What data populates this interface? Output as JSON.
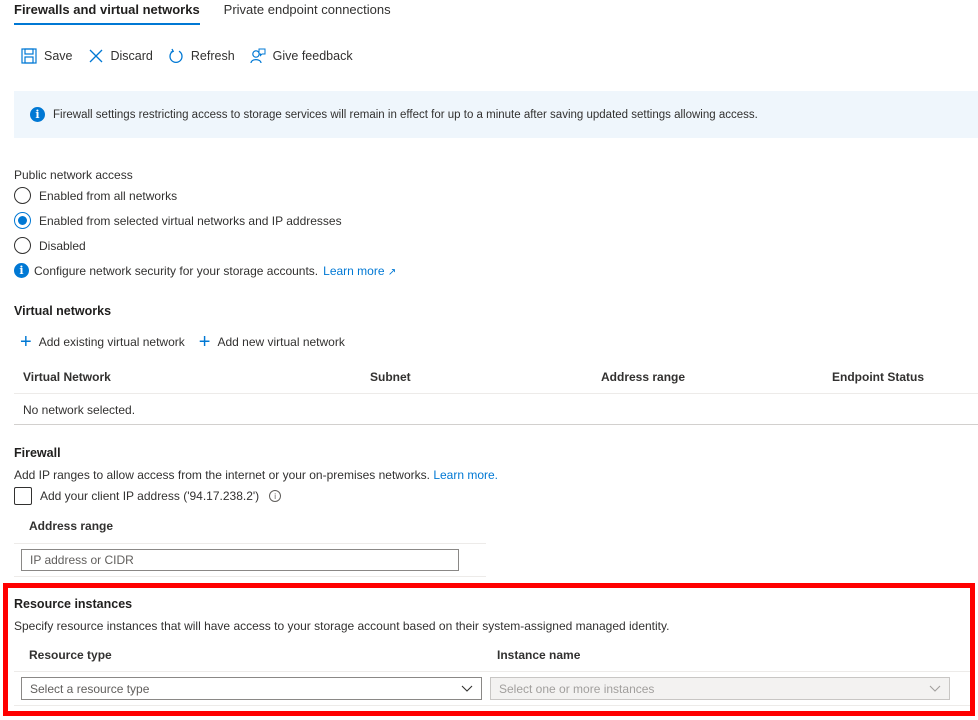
{
  "tabs": [
    {
      "label": "Firewalls and virtual networks",
      "active": true
    },
    {
      "label": "Private endpoint connections",
      "active": false
    }
  ],
  "toolbar": {
    "save": {
      "label": "Save",
      "icon": "save-icon"
    },
    "discard": {
      "label": "Discard",
      "icon": "close-icon"
    },
    "refresh": {
      "label": "Refresh",
      "icon": "refresh-icon"
    },
    "feedback": {
      "label": "Give feedback",
      "icon": "feedback-icon"
    }
  },
  "banner": {
    "icon": "info-icon",
    "text": "Firewall settings restricting access to storage services will remain in effect for up to a minute after saving updated settings allowing access."
  },
  "public_access": {
    "label": "Public network access",
    "options": [
      {
        "label": "Enabled from all networks",
        "selected": false
      },
      {
        "label": "Enabled from selected virtual networks and IP addresses",
        "selected": true
      },
      {
        "label": "Disabled",
        "selected": false
      }
    ],
    "info_text": "Configure network security for your storage accounts.",
    "learn_more": "Learn more"
  },
  "virtual_networks": {
    "title": "Virtual networks",
    "add_existing": "Add existing virtual network",
    "add_new": "Add new virtual network",
    "columns": [
      "Virtual Network",
      "Subnet",
      "Address range",
      "Endpoint Status"
    ],
    "empty_text": "No network selected."
  },
  "firewall": {
    "title": "Firewall",
    "description": "Add IP ranges to allow access from the internet or your on-premises networks.",
    "learn_more": "Learn more.",
    "client_ip_label": "Add your client IP address ('94.17.238.2')",
    "client_ip_checked": false,
    "address_range_header": "Address range",
    "address_placeholder": "IP address or CIDR"
  },
  "resource_instances": {
    "title": "Resource instances",
    "description": "Specify resource instances that will have access to your storage account based on their system-assigned managed identity.",
    "resource_type_header": "Resource type",
    "instance_name_header": "Instance name",
    "resource_type_placeholder": "Select a resource type",
    "instance_placeholder": "Select one or more instances"
  },
  "colors": {
    "accent": "#0078d4",
    "highlight_box": "#ff0000",
    "banner_bg": "#eff6fc"
  }
}
